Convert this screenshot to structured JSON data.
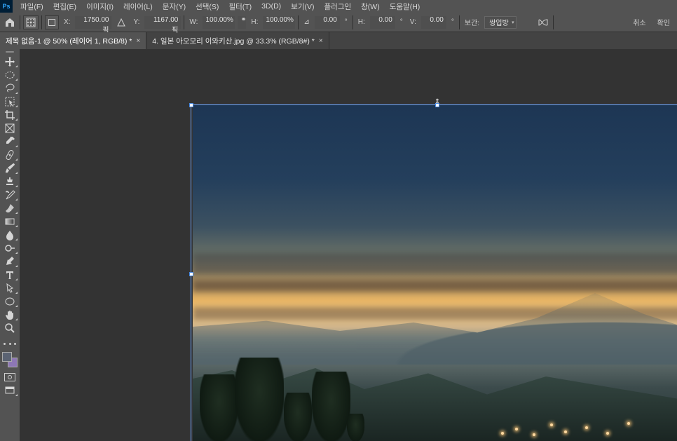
{
  "app_logo": "Ps",
  "menu": {
    "file": "파일(F)",
    "edit": "편집(E)",
    "image": "이미지(I)",
    "layer": "레이어(L)",
    "type": "문자(Y)",
    "select": "선택(S)",
    "filter": "필터(T)",
    "threeD": "3D(D)",
    "view": "보기(V)",
    "plugin": "플러그인",
    "window": "창(W)",
    "help": "도움말(H)"
  },
  "options": {
    "x_label": "X:",
    "x_value": "1750.00 픽",
    "y_label": "Y:",
    "y_value": "1167.00 픽",
    "w_label": "W:",
    "w_value": "100.00%",
    "link_icon": "⚭",
    "h_label": "H:",
    "h_value": "100.00%",
    "angle_label": "⊿",
    "angle_value": "0.00",
    "angle_unit": "°",
    "hskew_label": "H:",
    "hskew_value": "0.00",
    "hskew_unit": "°",
    "vskew_label": "V:",
    "vskew_value": "0.00",
    "vskew_unit": "°",
    "interpolation_label": "보간:",
    "interpolation_value": "쌍입방",
    "cancel": "취소",
    "confirm": "확인"
  },
  "tabs": {
    "active": "제목 없음-1 @ 50% (레이어 1, RGB/8) *",
    "inactive": "4. 일본 아오모리 이와키산.jpg @ 33.3% (RGB/8#) *"
  }
}
